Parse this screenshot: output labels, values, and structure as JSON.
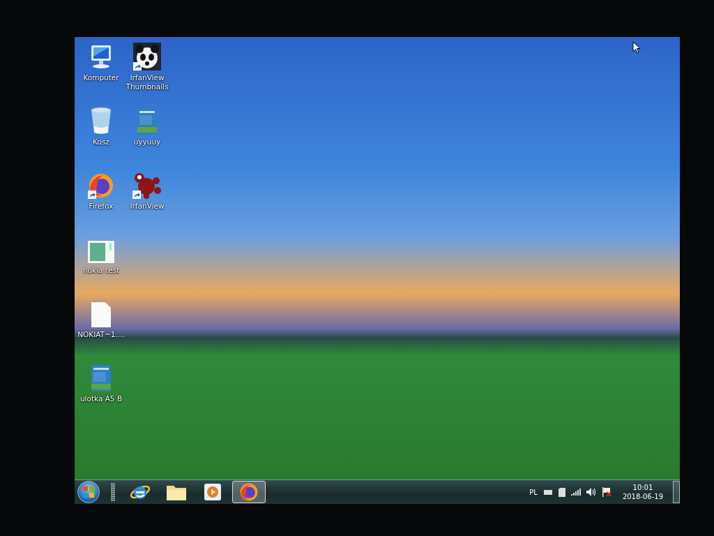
{
  "desktop_icons": [
    {
      "kind": "computer",
      "label": "Komputer",
      "shortcut": false
    },
    {
      "kind": "recycle-bin",
      "label": "Kosz",
      "shortcut": false
    },
    {
      "kind": "firefox",
      "label": "Firefox",
      "shortcut": true
    },
    {
      "kind": "image",
      "label": "nokia test",
      "shortcut": false
    },
    {
      "kind": "blank",
      "label": "NOKIAT~1....",
      "shortcut": false
    },
    {
      "kind": "document",
      "label": "ulotka A5 B",
      "shortcut": false
    },
    {
      "kind": "panda",
      "label": "IrfanView Thumbnails",
      "shortcut": true
    },
    {
      "kind": "document",
      "label": "uyyuuy",
      "shortcut": false
    },
    {
      "kind": "irfanview",
      "label": "IrfanView",
      "shortcut": true
    }
  ],
  "taskbar": {
    "pinned": [
      {
        "kind": "ie",
        "active": false
      },
      {
        "kind": "folder",
        "active": false
      },
      {
        "kind": "media",
        "active": false
      },
      {
        "kind": "firefox",
        "active": true
      }
    ],
    "language": "PL",
    "time": "10:01",
    "date": "2018-06-19"
  }
}
